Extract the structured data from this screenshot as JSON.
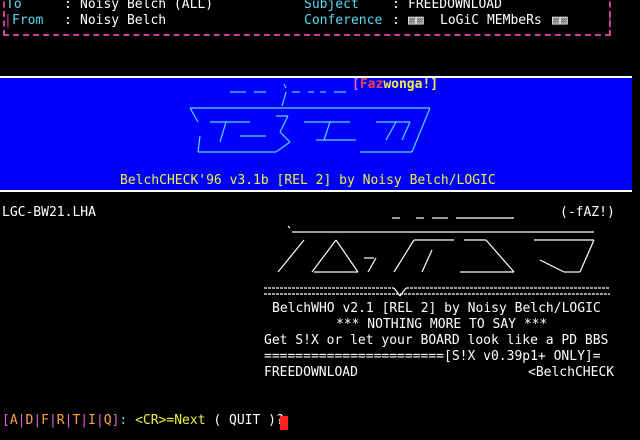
{
  "header": {
    "to_label": "To",
    "to_value": "Noisy Belch (ALL)",
    "from_label": "From",
    "from_value": "Noisy Belch",
    "subject_label": "Subject",
    "subject_value": "FREEDOWNLOAD",
    "conference_label": "Conference",
    "conference_value": "LoGiC MEMbeRs"
  },
  "banner": {
    "tag": "[Fazwonga!]",
    "tag_parts": [
      "[",
      "Faz",
      "wonga",
      "!]"
    ],
    "ansi_logo": [
      "        _ __  _:_ _ _      ",
      "       ____ __/ _________  ",
      "      \\ __|/ / \\  __|  _ \\ ",
      "       |__  \\_>  |  __/    ",
      "       /___/|___/|__|      "
    ],
    "credit": "BelchCHECK'96 v3.1b [REL 2] by Noisy Belch/LOGIC"
  },
  "body": {
    "filename": "LGC-BW21.LHA",
    "author_tag": "(-fAZ!)",
    "art_lines": [
      "                                  _  _ ___ _______",
      "                                 .:________________________________",
      "                                  /  /\\   7  /  __  /  _  \\  /  _/",
      "                                 /  /__\\ /  /  /  /  /  /  / \\__  \\",
      "                                ============\\/=========================="
    ],
    "lines": [
      "BelchWHO v2.1 [REL 2] by Noisy Belch/LOGIC",
      "*** NOTHING MORE TO SAY ***",
      "Get S!X or let your BOARD look like a PD BBS",
      "=======================[S!X v0.39p1+ ONLY]=",
      "FREEDOWNLOAD"
    ],
    "right_tag": "<BelchCHECK"
  },
  "prompt": {
    "keys": [
      "A",
      "D",
      "F",
      "R",
      "T",
      "I",
      "Q"
    ],
    "cr_text": "<CR>=Next",
    "quit_text": "( QUIT )?"
  },
  "colors": {
    "header_border": "#d03fae",
    "banner_bg": "#0000ff",
    "label_cyan": "#58d8f0",
    "credit_yellow": "#f0f040",
    "cursor_red": "#ff2020"
  }
}
